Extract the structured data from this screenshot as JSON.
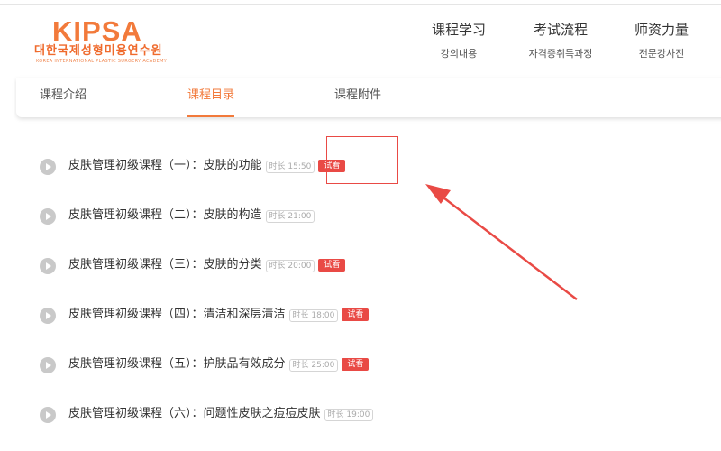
{
  "logo": {
    "brand": "KIPSA",
    "korean": "대한국제성형미용연수원",
    "english": "KOREA INTERNATIONAL PLASTIC SURGERY ACADEMY"
  },
  "nav": [
    {
      "title": "课程学习",
      "sub": "강의내용"
    },
    {
      "title": "考试流程",
      "sub": "자격증취득과정"
    },
    {
      "title": "师资力量",
      "sub": "전문강사진"
    }
  ],
  "tabs": [
    {
      "label": "课程介绍",
      "active": false
    },
    {
      "label": "课程目录",
      "active": true
    },
    {
      "label": "课程附件",
      "active": false
    }
  ],
  "courses": [
    {
      "title": "皮肤管理初级课程（一）：皮肤的功能",
      "duration": "时长 15:50",
      "preview": "试看"
    },
    {
      "title": "皮肤管理初级课程（二）：皮肤的构造",
      "duration": "时长 21:00",
      "preview": ""
    },
    {
      "title": "皮肤管理初级课程（三）：皮肤的分类",
      "duration": "时长 20:00",
      "preview": "试看"
    },
    {
      "title": "皮肤管理初级课程（四）：清洁和深层清洁",
      "duration": "时长 18:00",
      "preview": "试看"
    },
    {
      "title": "皮肤管理初级课程（五）：护肤品有效成分",
      "duration": "时长 25:00",
      "preview": "试看"
    },
    {
      "title": "皮肤管理初级课程（六）：问题性皮肤之痘痘皮肤",
      "duration": "时长 19:00",
      "preview": ""
    }
  ],
  "colors": {
    "brand": "#f27a3b",
    "badge": "#e94a45",
    "annotation": "#e94a45"
  }
}
